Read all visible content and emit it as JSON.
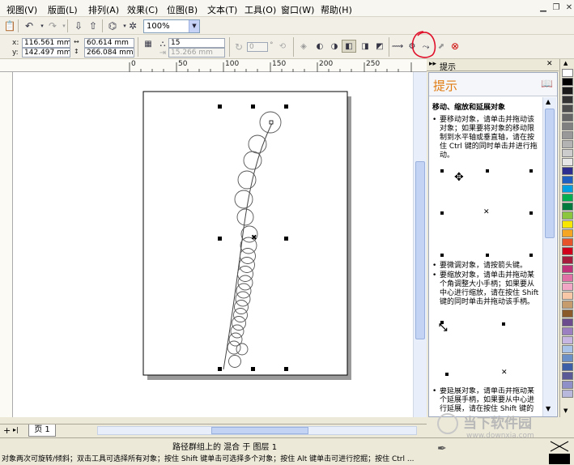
{
  "menubar": {
    "items": [
      "视图(V)",
      "版面(L)",
      "排列(A)",
      "效果(C)",
      "位图(B)",
      "文本(T)",
      "工具(O)",
      "窗口(W)",
      "帮助(H)"
    ]
  },
  "toolbar": {
    "zoom": "100%"
  },
  "property_bar": {
    "x": "116.561 mm",
    "y": "142.497 mm",
    "width": "60.614 mm",
    "height": "266.084 mm",
    "x_label": "x:",
    "y_label": "y:",
    "blend_steps": "15",
    "blend_spacing": "15.266 mm",
    "rotation": "0",
    "rotation_unit": "°"
  },
  "ruler": {
    "labels": [
      "0",
      "50",
      "100",
      "150",
      "200",
      "250"
    ]
  },
  "docker": {
    "tab_title": "提示",
    "heading": "提示",
    "section_title": "移动、缩放和延展对象",
    "tips": [
      "要移动对象，请单击并拖动该对象；如果要将对象的移动限制到水平轴或垂直轴，请在按住 Ctrl 键的同时单击并进行拖动。",
      "要微调对象，请按箭头键。",
      "要缩放对象，请单击并拖动某个角调整大小手柄；如果要从中心进行缩放，请在按住 Shift 键的同时单击并拖动该手柄。",
      "要延展对象，请单击并拖动某个延展手柄，如果要从中心进行延展，请在按住 Shift 键的"
    ]
  },
  "page_tab": {
    "label": "页 1"
  },
  "status": {
    "line1": "路径群组上的 混合 于 图层 1",
    "line2": "对象两次可旋转/倾斜；双击工具可选择所有对象；按住 Shift 键单击可选择多个对象；按住 Alt 键单击可进行挖掘；按住 Ctrl ..."
  },
  "watermark": {
    "brand": "当下软件园",
    "url": "www.downxia.com"
  },
  "palette": {
    "colors": [
      "#ffffff",
      "#000000",
      "#1a1a1a",
      "#333333",
      "#4d4d4d",
      "#666666",
      "#808080",
      "#999999",
      "#b3b3b3",
      "#cccccc",
      "#e6e6e6",
      "#2d2d8f",
      "#1f5fbf",
      "#00a0e0",
      "#00b050",
      "#007a3d",
      "#8cc63f",
      "#f7e600",
      "#f5a623",
      "#e8542a",
      "#d0021b",
      "#a61c3c",
      "#c0337a",
      "#e06fa6",
      "#f2a6c6",
      "#f7c7a6",
      "#c69c6d",
      "#8b5a2b",
      "#6d4c8e",
      "#9b7fc0",
      "#c8b6e2",
      "#a9c3e8",
      "#6b8fc7",
      "#3d5fa8",
      "#5a5a96",
      "#9090c8",
      "#b8b8dc"
    ]
  }
}
